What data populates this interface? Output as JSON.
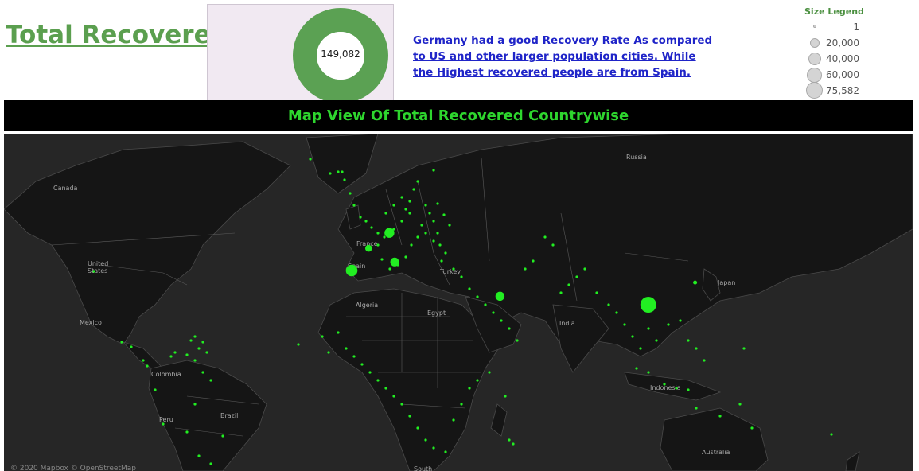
{
  "header": {
    "title": "Total Recovered",
    "donut_value": "149,082",
    "donut_color": "#5ba153",
    "insight": "Germany had a good Recovery Rate As compared to US and other larger population cities. While the Highest recovered people are from Spain."
  },
  "size_legend": {
    "title": "Size Legend",
    "items": [
      "1",
      "20,000",
      "40,000",
      "60,000",
      "75,582"
    ]
  },
  "map": {
    "banner": "Map View Of Total Recovered Countrywise",
    "labels": [
      "Canada",
      "United States",
      "Mexico",
      "Colombia",
      "Peru",
      "Brazil",
      "Russia",
      "France",
      "Spain",
      "Turkey",
      "Algeria",
      "Egypt",
      "India",
      "Japan",
      "Indonesia",
      "Australia",
      "South"
    ],
    "credit": "© 2020 Mapbox © OpenStreetMap",
    "marker_color": "#22ee22",
    "big_markers": [
      {
        "name": "China",
        "lon": 110,
        "lat": 30,
        "value": 75582
      },
      {
        "name": "Spain",
        "lon": -4,
        "lat": 40,
        "value": 40437
      },
      {
        "name": "Italy",
        "lon": 12.5,
        "lat": 42.5,
        "value": 22837
      },
      {
        "name": "Germany",
        "lon": 10.5,
        "lat": 51,
        "value": 28700
      },
      {
        "name": "Iran",
        "lon": 53,
        "lat": 32.5,
        "value": 24236
      },
      {
        "name": "France",
        "lon": 2.5,
        "lat": 46.5,
        "value": 14008
      },
      {
        "name": "South Korea",
        "lon": 128,
        "lat": 36.5,
        "value": 4529
      }
    ]
  }
}
